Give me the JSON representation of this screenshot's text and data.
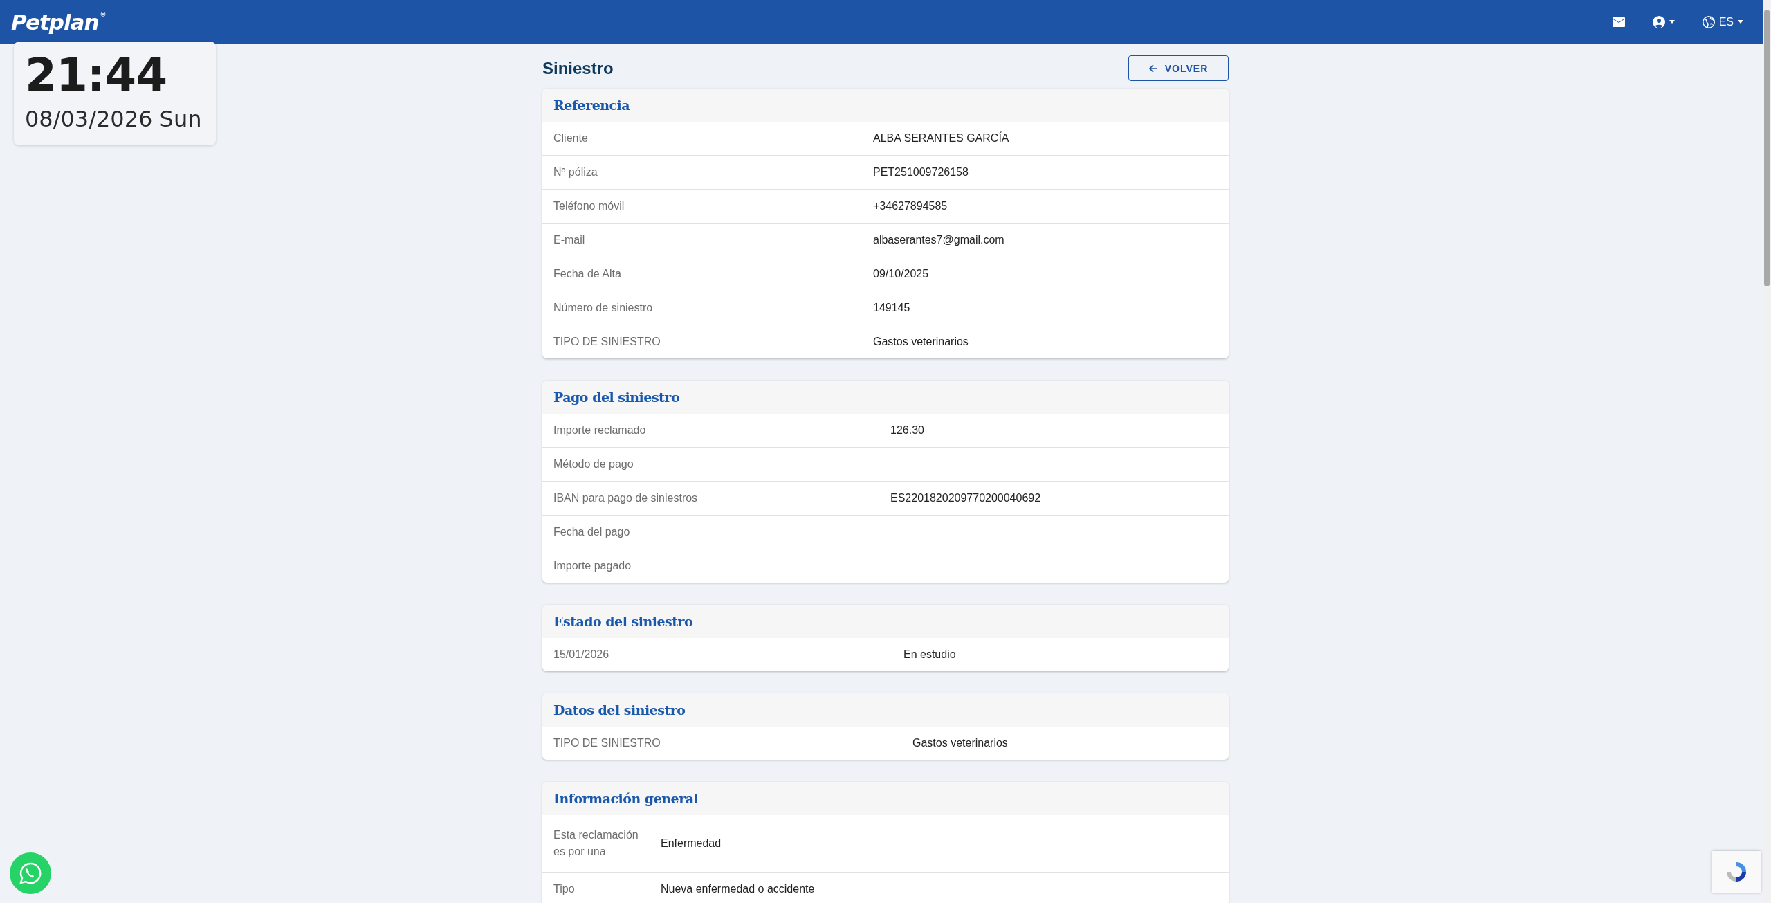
{
  "header": {
    "logo": "Petplan",
    "logo_mark": "®",
    "language": "ES"
  },
  "clock": {
    "time": "21:44",
    "date": "08/03/2026 Sun"
  },
  "page": {
    "title": "Siniestro",
    "back_button": "VOLVER"
  },
  "sections": [
    {
      "title": "Referencia",
      "rows": [
        {
          "label": "Cliente",
          "value": "ALBA SERANTES GARCÍA"
        },
        {
          "label": "Nº póliza",
          "value": "PET251009726158"
        },
        {
          "label": "Teléfono móvil",
          "value": "+34627894585"
        },
        {
          "label": "E-mail",
          "value": "albaserantes7@gmail.com"
        },
        {
          "label": "Fecha de Alta",
          "value": "09/10/2025"
        },
        {
          "label": "Número de siniestro",
          "value": "149145"
        },
        {
          "label": "TIPO DE SINIESTRO",
          "value": "Gastos veterinarios"
        }
      ]
    },
    {
      "title": "Pago del siniestro",
      "rows": [
        {
          "label": "Importe reclamado",
          "value": "126.30"
        },
        {
          "label": "Método de pago"
        },
        {
          "label": "IBAN para pago de siniestros",
          "value": "ES2201820209770200040692"
        },
        {
          "label": "Fecha del pago"
        },
        {
          "label": "Importe pagado"
        }
      ]
    },
    {
      "title": "Estado del siniestro",
      "rows": [
        {
          "label": "15/01/2026",
          "value": "En estudio"
        }
      ]
    },
    {
      "title": "Datos del siniestro",
      "rows": [
        {
          "label": "TIPO DE SINIESTRO",
          "value": "Gastos veterinarios"
        }
      ]
    },
    {
      "title": "Información general",
      "rows": [
        {
          "label": "Esta reclamación es por una",
          "value": "Enfermedad"
        },
        {
          "label": "Tipo",
          "value": "Nueva enfermedad o accidente"
        }
      ]
    }
  ]
}
